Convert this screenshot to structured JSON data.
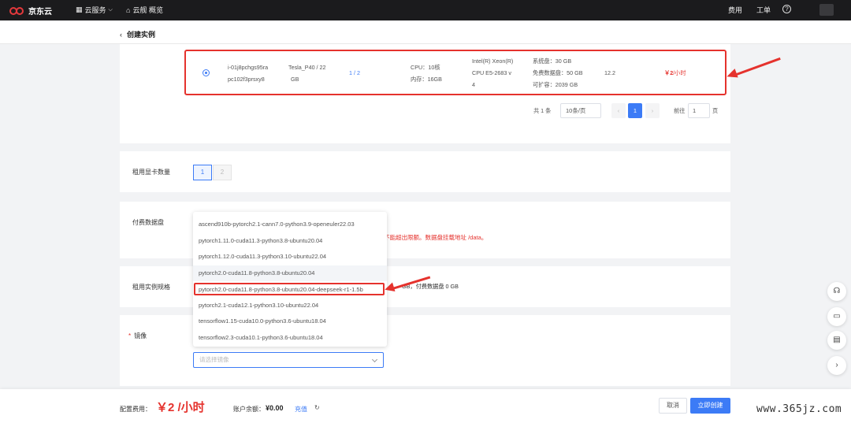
{
  "brand": {
    "name": "京东云"
  },
  "topbar": {
    "cloud_services": "云服务",
    "overview": "云舰 概览",
    "billing": "费用",
    "tickets": "工单",
    "help": "?"
  },
  "header": {
    "title": "创建实例"
  },
  "instance_row": {
    "id_line1": "i-01j8pchgs95ra",
    "id_line2": "pc102f3prsxy8",
    "gpu_line1": "Tesla_P40 / 22",
    "gpu_line2": "GB",
    "gpu_count": "1 / 2",
    "cpu": "CPU：10核",
    "mem": "内存：16GB",
    "cpu_model_1": "Intel(R) Xeon(R)",
    "cpu_model_2": "CPU E5-2683 v",
    "cpu_model_3": "4",
    "disk_sys": "系统盘：30 GB",
    "disk_free": "免费数据盘：50 GB",
    "disk_exp": "可扩容：2039 GB",
    "cuda": "12.2",
    "price_amount": "￥2",
    "price_unit": "/小时"
  },
  "pagination": {
    "total": "共 1 条",
    "page_size": "10条/页",
    "prev": "‹",
    "current": "1",
    "next": "›",
    "goto_label": "前往",
    "goto_value": "1",
    "page_suffix": "页"
  },
  "gpu_rent": {
    "label": "租用显卡数量",
    "options": [
      "1",
      "2"
    ]
  },
  "paid_disk": {
    "label": "付费数据盘",
    "note": "不能超出限额。数据盘挂载地址 /data。"
  },
  "spec": {
    "label": "租用实例规格",
    "value": "GB，付费数据盘 0 GB"
  },
  "image": {
    "required_mark": "*",
    "label": "镜像",
    "placeholder": "请选择镜像",
    "options": [
      "ascend910b-pytorch2.1-cann7.0-python3.9-openeuler22.03",
      "pytorch1.11.0-cuda11.3-python3.8-ubuntu20.04",
      "pytorch1.12.0-cuda11.3-python3.10-ubuntu22.04",
      "pytorch2.0-cuda11.8-python3.8-ubuntu20.04",
      "pytorch2.0-cuda11.8-python3.8-ubuntu20.04-deepseek-r1-1.5b",
      "pytorch2.1-cuda12.1-python3.10-ubuntu22.04",
      "tensorflow1.15-cuda10.0-python3.6-ubuntu18.04",
      "tensorflow2.3-cuda10.1-python3.6-ubuntu18.04"
    ]
  },
  "footer": {
    "fee_label": "配置费用：",
    "fee_value": "￥2 /小时",
    "balance_label": "账户余额：",
    "balance_value": "¥0.00",
    "recharge": "充值",
    "cancel": "取消",
    "create": "立即创建"
  },
  "watermark": "www.365jz.com",
  "colors": {
    "accent": "#3c7bf6",
    "alert": "#e5322d",
    "topbar": "#1b1b1d"
  }
}
